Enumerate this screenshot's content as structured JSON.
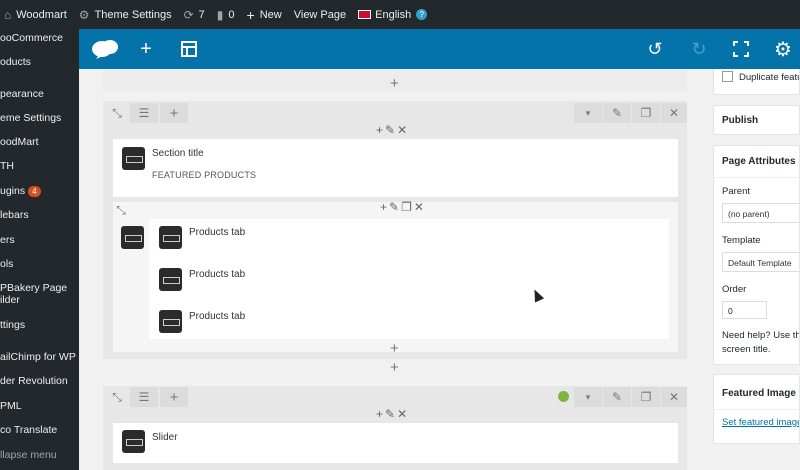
{
  "adminbar": {
    "site_name": "Woodmart",
    "theme_settings": "Theme Settings",
    "updates_count": "7",
    "comments_count": "0",
    "new_label": "New",
    "view_page": "View Page",
    "language": "English",
    "help": "?"
  },
  "sidebar": {
    "items": [
      {
        "label": "ooCommerce"
      },
      {
        "label": "oducts"
      },
      {
        "label": "pearance"
      },
      {
        "label": "eme Settings"
      },
      {
        "label": "oodMart"
      },
      {
        "label": "TH"
      },
      {
        "label": "ugins",
        "badge": "4"
      },
      {
        "label": "lebars"
      },
      {
        "label": "ers"
      },
      {
        "label": "ols"
      },
      {
        "label": "PBakery Page"
      },
      {
        "label": "ilder"
      },
      {
        "label": "ttings"
      },
      {
        "label": "ailChimp for WP"
      },
      {
        "label": "der Revolution"
      },
      {
        "label": "PML"
      },
      {
        "label": "co Translate"
      },
      {
        "label": "llapse menu"
      }
    ]
  },
  "canvas": {
    "section_title_element": {
      "title": "Section title",
      "subtitle": "FEATURED PRODUCTS"
    },
    "products_tabs": [
      {
        "title": "Products tab"
      },
      {
        "title": "Products tab"
      },
      {
        "title": "Products tab"
      }
    ],
    "slider_element": {
      "title": "Slider"
    }
  },
  "right_panel": {
    "duplicate_label": "Duplicate featu",
    "publish_title": "Publish",
    "page_attributes_title": "Page Attributes",
    "parent_label": "Parent",
    "parent_value": "(no parent)",
    "template_label": "Template",
    "template_value": "Default Template",
    "order_label": "Order",
    "order_value": "0",
    "help_text_1": "Need help? Use the",
    "help_text_2": "screen title.",
    "featured_image_title": "Featured Image",
    "set_featured_link": "Set featured image"
  },
  "colors": {
    "adminbar_bg": "#23282d",
    "toolbar_bg": "#0473aa",
    "badge": "#d54e21",
    "status_dot": "#7ab641",
    "link": "#0073aa"
  }
}
